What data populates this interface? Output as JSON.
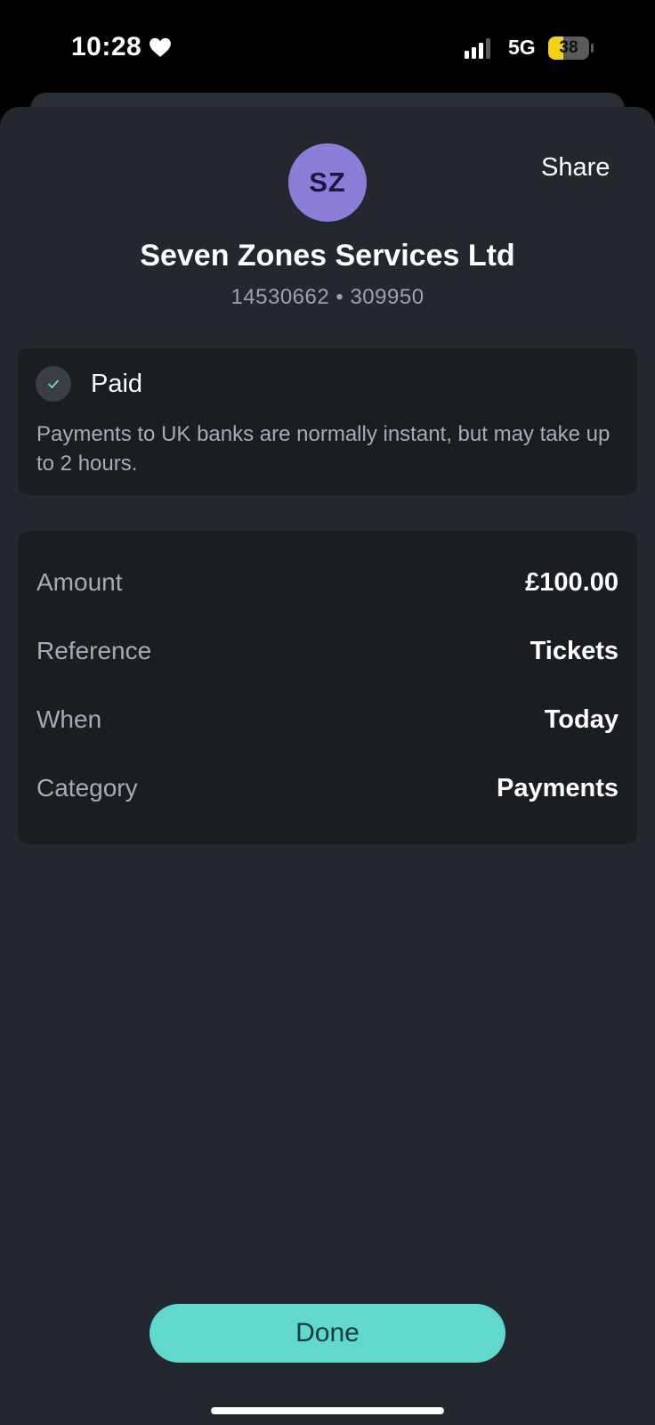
{
  "status_bar": {
    "time": "10:28",
    "network": "5G",
    "battery_level": "38",
    "battery_fraction": 0.38,
    "signal_bars_active": 3,
    "signal_bars_total": 4
  },
  "header": {
    "share_label": "Share",
    "avatar_initials": "SZ",
    "avatar_color": "#8c7ed8",
    "merchant_name": "Seven Zones Services Ltd",
    "account_details": "14530662 • 309950"
  },
  "status": {
    "icon": "check-icon",
    "title": "Paid",
    "description": "Payments to UK banks are normally instant, but may take up to 2 hours."
  },
  "details": {
    "rows": [
      {
        "label": "Amount",
        "value": "£100.00"
      },
      {
        "label": "Reference",
        "value": "Tickets"
      },
      {
        "label": "When",
        "value": "Today"
      },
      {
        "label": "Category",
        "value": "Payments"
      }
    ]
  },
  "footer": {
    "done_label": "Done",
    "accent_color": "#61d8cc"
  }
}
